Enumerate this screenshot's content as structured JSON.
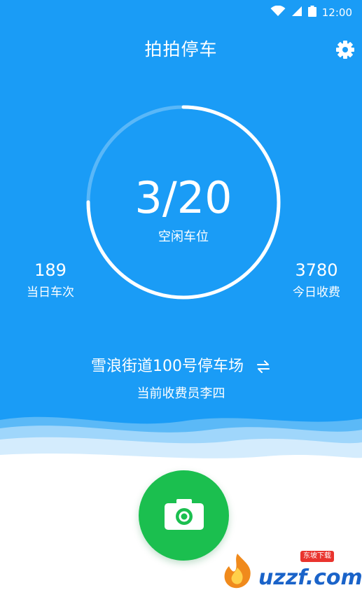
{
  "status_bar": {
    "time": "12:00",
    "icons": [
      "wifi-icon",
      "cellular-signal-icon",
      "battery-icon"
    ]
  },
  "header": {
    "title": "拍拍停车",
    "settings_icon": "gear-icon"
  },
  "occupancy": {
    "value": "3/20",
    "label": "空闲车位",
    "ring_progress": 0.75
  },
  "stats": {
    "daily_trips": {
      "value": "189",
      "label": "当日车次"
    },
    "daily_fees": {
      "value": "3780",
      "label": "今日收费"
    }
  },
  "parking_lot": {
    "name": "雪浪街道100号停车场",
    "switch_icon": "swap-arrows-icon"
  },
  "collector": {
    "text": "当前收费员李四"
  },
  "camera": {
    "icon": "camera-icon"
  },
  "watermark": {
    "text": "uzzf.com",
    "badge": "东坡下载"
  },
  "colors": {
    "primary_blue": "#1a9cf6",
    "camera_green": "#1bbf4f",
    "white": "#ffffff"
  }
}
